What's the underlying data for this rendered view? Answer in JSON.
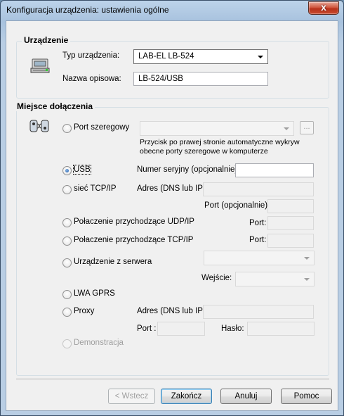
{
  "window": {
    "title": "Konfiguracja urządzenia: ustawienia ogólne",
    "close_glyph": "x"
  },
  "device_group": {
    "title": "Urządzenie",
    "type_label": "Typ urządzenia:",
    "type_value": "LAB-EL LB-524",
    "name_label": "Nazwa opisowa:",
    "name_value": "LB-524/USB"
  },
  "connection_group": {
    "title": "Miejsce dołączenia",
    "serial": {
      "label": "Port szeregowy",
      "browse": "...",
      "hint_line1": "Przycisk po prawej stronie automatyczne wykryw",
      "hint_line2": "obecne porty szeregowe w komputerze"
    },
    "usb": {
      "label": "USB",
      "serial_label": "Numer seryjny (opcjonalnie):",
      "serial_value": ""
    },
    "tcpip": {
      "label": "sieć TCP/IP",
      "address_label": "Adres (DNS lub IP):",
      "port_label": "Port (opcjonalnie):"
    },
    "udp_in": {
      "label": "Połaczenie przychodzące UDP/IP",
      "port_label": "Port:"
    },
    "tcp_in": {
      "label": "Połaczenie przychodzące TCP/IP",
      "port_label": "Port:"
    },
    "server": {
      "label": "Urządzenie z serwera",
      "input_label": "Wejście:"
    },
    "gprs": {
      "label": "LWA GPRS"
    },
    "proxy": {
      "label": "Proxy",
      "address_label": "Adres (DNS lub IP):",
      "port_label": "Port :",
      "password_label": "Hasło:"
    },
    "demo": {
      "label": "Demonstracja"
    }
  },
  "footer": {
    "back": "< Wstecz",
    "finish": "Zakończ",
    "cancel": "Anuluj",
    "help": "Pomoc"
  }
}
